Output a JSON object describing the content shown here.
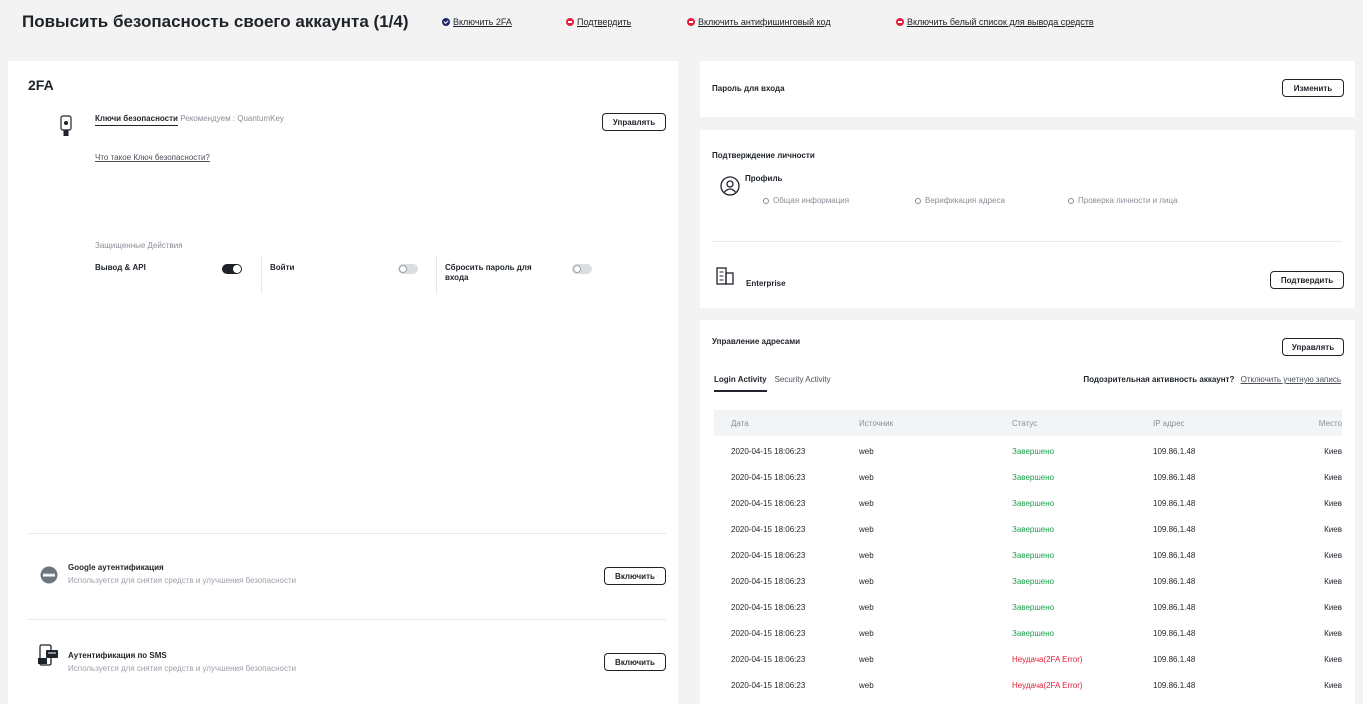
{
  "header": {
    "title": "Повысить безопасность своего аккаунта (1/4)",
    "steps": [
      {
        "label": "Включить 2FA",
        "status": "done"
      },
      {
        "label": "Подтвердить",
        "status": "todo"
      },
      {
        "label": "Включить антифишинговый код",
        "status": "todo"
      },
      {
        "label": "Включить белый список для вывода средств",
        "status": "todo"
      }
    ]
  },
  "twofa": {
    "title": "2FA",
    "security_key": {
      "name": "Ключи безопасности",
      "recommendation": "Рекомендуем : QuantumKey",
      "manage_label": "Управлять",
      "what_link": "Что такое Ключ безопасности?"
    },
    "protected_actions_label": "Защищенные Действия",
    "actions": [
      {
        "label": "Вывод & API",
        "on": true
      },
      {
        "label": "Войти",
        "on": false
      },
      {
        "label": "Сбросить пароль для входа",
        "on": false
      }
    ],
    "google": {
      "title": "Google аутентификация",
      "sub": "Используется для снятия средств и улучшения безопасности",
      "button": "Включить"
    },
    "sms": {
      "title": "Аутентификация по SMS",
      "sub": "Используется для снятия средств и улучшения безопасности",
      "button": "Включить"
    }
  },
  "password": {
    "title": "Пароль для входа",
    "button": "Изменить"
  },
  "identity": {
    "title": "Подтверждение личности",
    "profile_label": "Профиль",
    "profile_steps": [
      "Общая информация",
      "Верификация адреса",
      "Проверка личности и лица"
    ],
    "enterprise_label": "Enterprise",
    "enterprise_button": "Подтвердить"
  },
  "addresses": {
    "title": "Управление адресами",
    "button": "Управлять",
    "tabs": [
      "Login Activity",
      "Security Activity"
    ],
    "suspicious_q": "Подозрительная активность аккаунт?",
    "disable_link": "Отключить учетную запись",
    "columns": [
      "Дата",
      "Источник",
      "Статус",
      "IP адрес",
      "Место"
    ],
    "rows": [
      {
        "date": "2020-04-15 18:06:23",
        "source": "web",
        "status": "Завершено",
        "ip": "109.86.1.48",
        "place": "Киев"
      },
      {
        "date": "2020-04-15 18:06:23",
        "source": "web",
        "status": "Завершено",
        "ip": "109.86.1.48",
        "place": "Киев"
      },
      {
        "date": "2020-04-15 18:06:23",
        "source": "web",
        "status": "Завершено",
        "ip": "109.86.1.48",
        "place": "Киев"
      },
      {
        "date": "2020-04-15 18:06:23",
        "source": "web",
        "status": "Завершено",
        "ip": "109.86.1.48",
        "place": "Киев"
      },
      {
        "date": "2020-04-15 18:06:23",
        "source": "web",
        "status": "Завершено",
        "ip": "109.86.1.48",
        "place": "Киев"
      },
      {
        "date": "2020-04-15 18:06:23",
        "source": "web",
        "status": "Завершено",
        "ip": "109.86.1.48",
        "place": "Киев"
      },
      {
        "date": "2020-04-15 18:06:23",
        "source": "web",
        "status": "Завершено",
        "ip": "109.86.1.48",
        "place": "Киев"
      },
      {
        "date": "2020-04-15 18:06:23",
        "source": "web",
        "status": "Завершено",
        "ip": "109.86.1.48",
        "place": "Киев"
      },
      {
        "date": "2020-04-15 18:06:23",
        "source": "web",
        "status": "Неудача(2FA Error)",
        "ip": "109.86.1.48",
        "place": "Киев"
      },
      {
        "date": "2020-04-15 18:06:23",
        "source": "web",
        "status": "Неудача(2FA Error)",
        "ip": "109.86.1.48",
        "place": "Киев"
      }
    ]
  },
  "colors": {
    "success": "#1b9e4b",
    "error": "#e0203a",
    "accent": "#1e2a6e"
  }
}
